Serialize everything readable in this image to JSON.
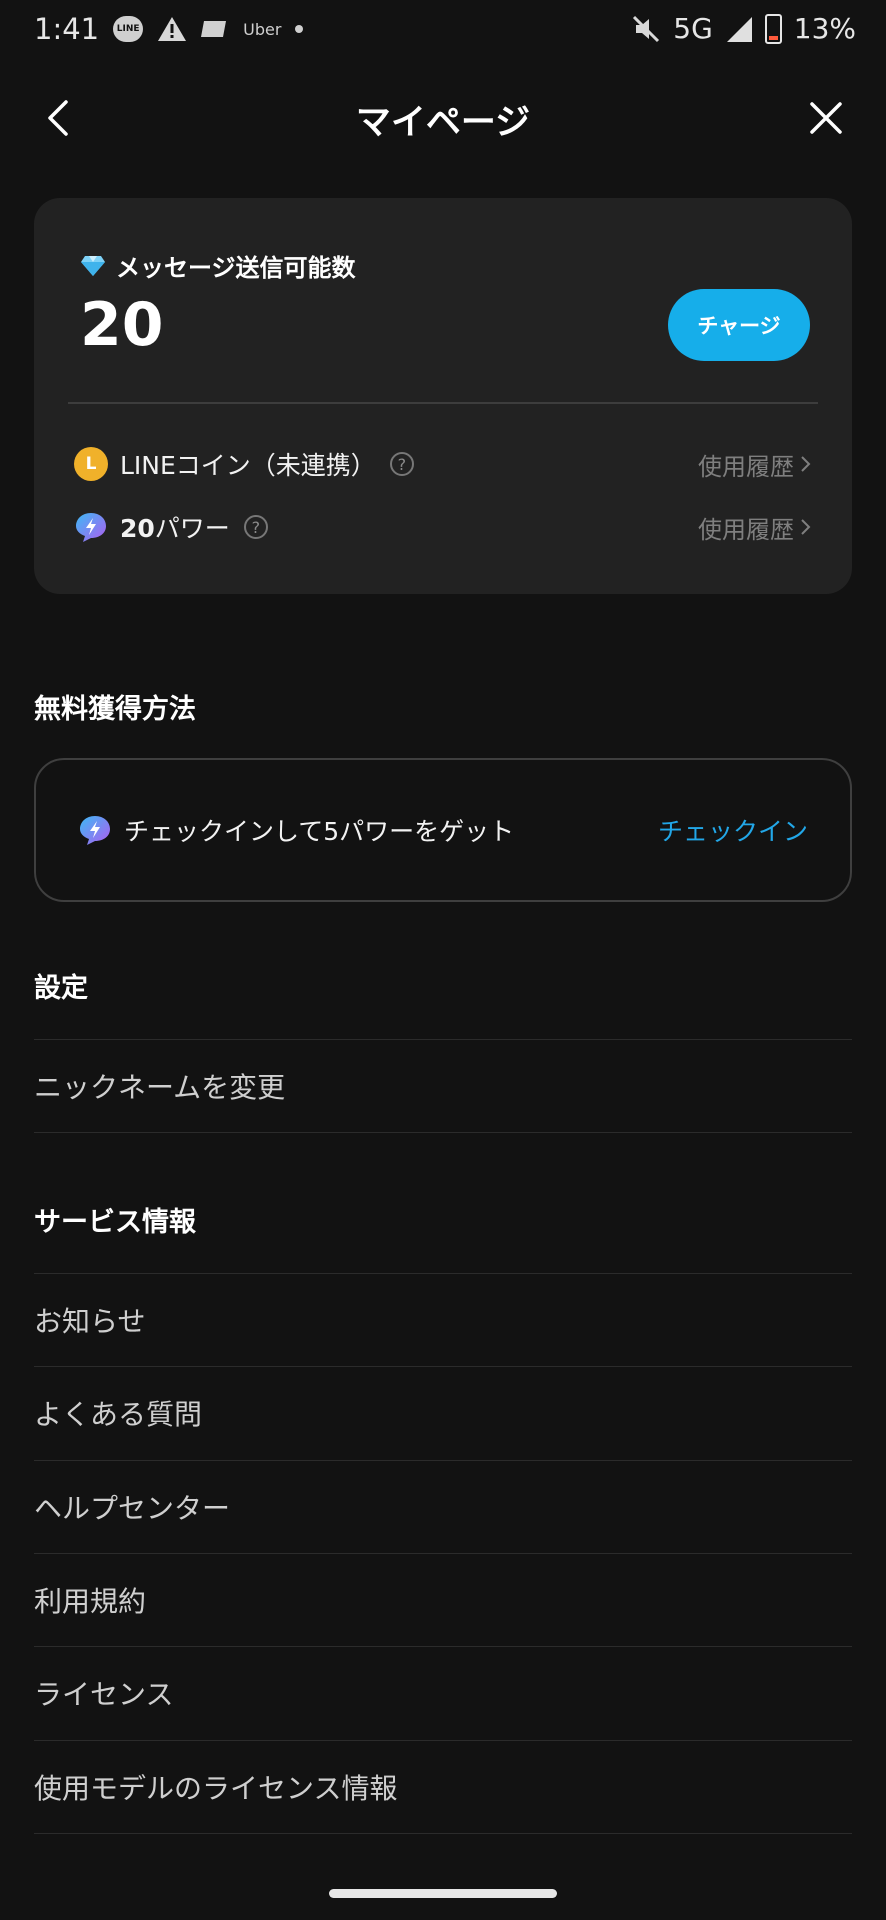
{
  "status": {
    "time": "1:41",
    "line": "LINE",
    "uber": "Uber",
    "network": "5G",
    "battery": "13%"
  },
  "header": {
    "title": "マイページ"
  },
  "balance": {
    "label": "メッセージ送信可能数",
    "count": "20",
    "charge": "チャージ",
    "coin_label": "LINEコイン（未連携）",
    "coin_icon_letter": "L",
    "power_value": "20",
    "power_unit": "パワー",
    "history": "使用履歴",
    "help": "?"
  },
  "free": {
    "title": "無料獲得方法",
    "text": "チェックインして5パワーをゲット",
    "action": "チェックイン"
  },
  "settings": {
    "title": "設定",
    "items": [
      "ニックネームを変更"
    ]
  },
  "service": {
    "title": "サービス情報",
    "items": [
      "お知らせ",
      "よくある質問",
      "ヘルプセンター",
      "利用規約",
      "ライセンス",
      "使用モデルのライセンス情報"
    ]
  },
  "colors": {
    "accent": "#16aeea",
    "link": "#22a7e8",
    "background": "#121212",
    "card": "#222222"
  }
}
